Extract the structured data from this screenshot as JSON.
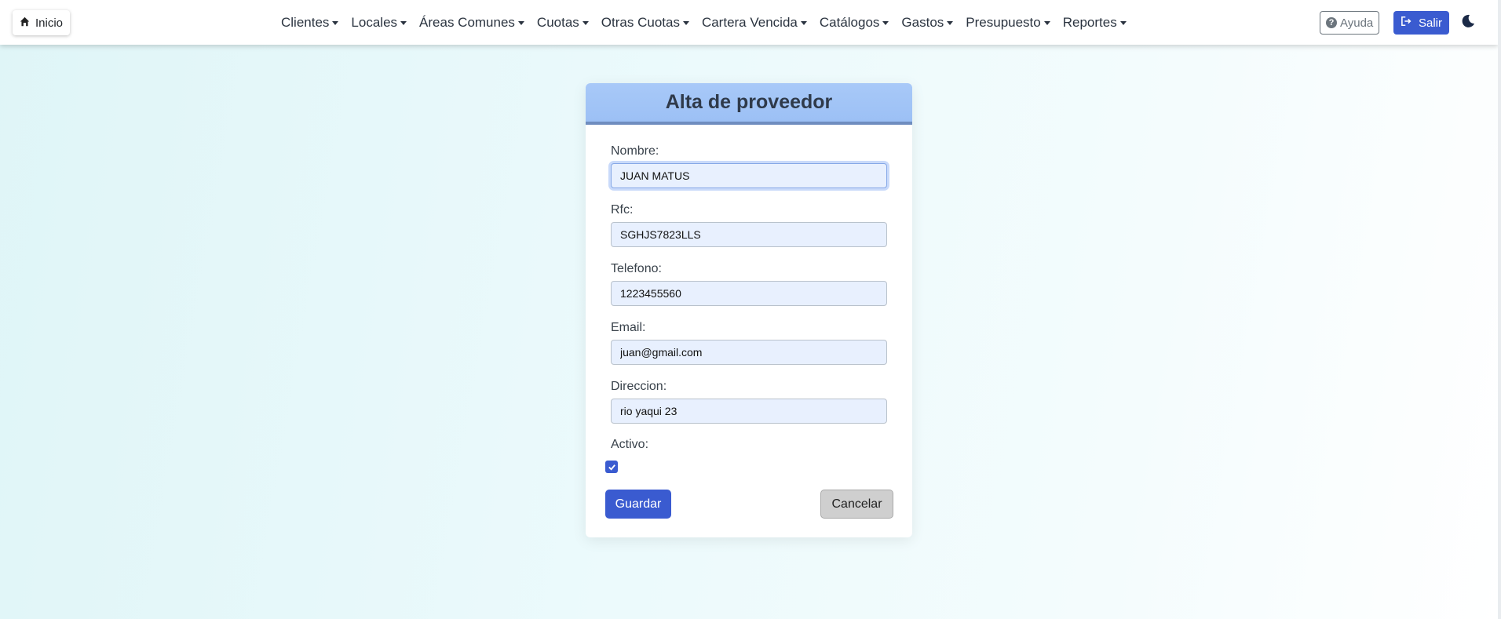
{
  "nav": {
    "home_label": "Inicio",
    "menu": [
      {
        "label": "Clientes"
      },
      {
        "label": "Locales"
      },
      {
        "label": "Áreas Comunes"
      },
      {
        "label": "Cuotas"
      },
      {
        "label": "Otras Cuotas"
      },
      {
        "label": "Cartera Vencida"
      },
      {
        "label": "Catálogos"
      },
      {
        "label": "Gastos"
      },
      {
        "label": "Presupuesto"
      },
      {
        "label": "Reportes"
      }
    ],
    "help_label": "Ayuda",
    "help_icon": "?",
    "exit_label": "Salir"
  },
  "form": {
    "title": "Alta de proveedor",
    "fields": [
      {
        "label": "Nombre:",
        "value": "JUAN MATUS"
      },
      {
        "label": "Rfc:",
        "value": "SGHJS7823LLS"
      },
      {
        "label": "Telefono:",
        "value": "1223455560"
      },
      {
        "label": "Email:",
        "value": "juan@gmail.com"
      },
      {
        "label": "Direccion:",
        "value": "rio yaqui 23"
      }
    ],
    "active_label": "Activo:",
    "active_checked": true,
    "save_label": "Guardar",
    "cancel_label": "Cancelar"
  },
  "colors": {
    "primary": "#3a5bd0",
    "header_bg": "#a8c9f8",
    "input_bg": "#e8f0fe"
  }
}
